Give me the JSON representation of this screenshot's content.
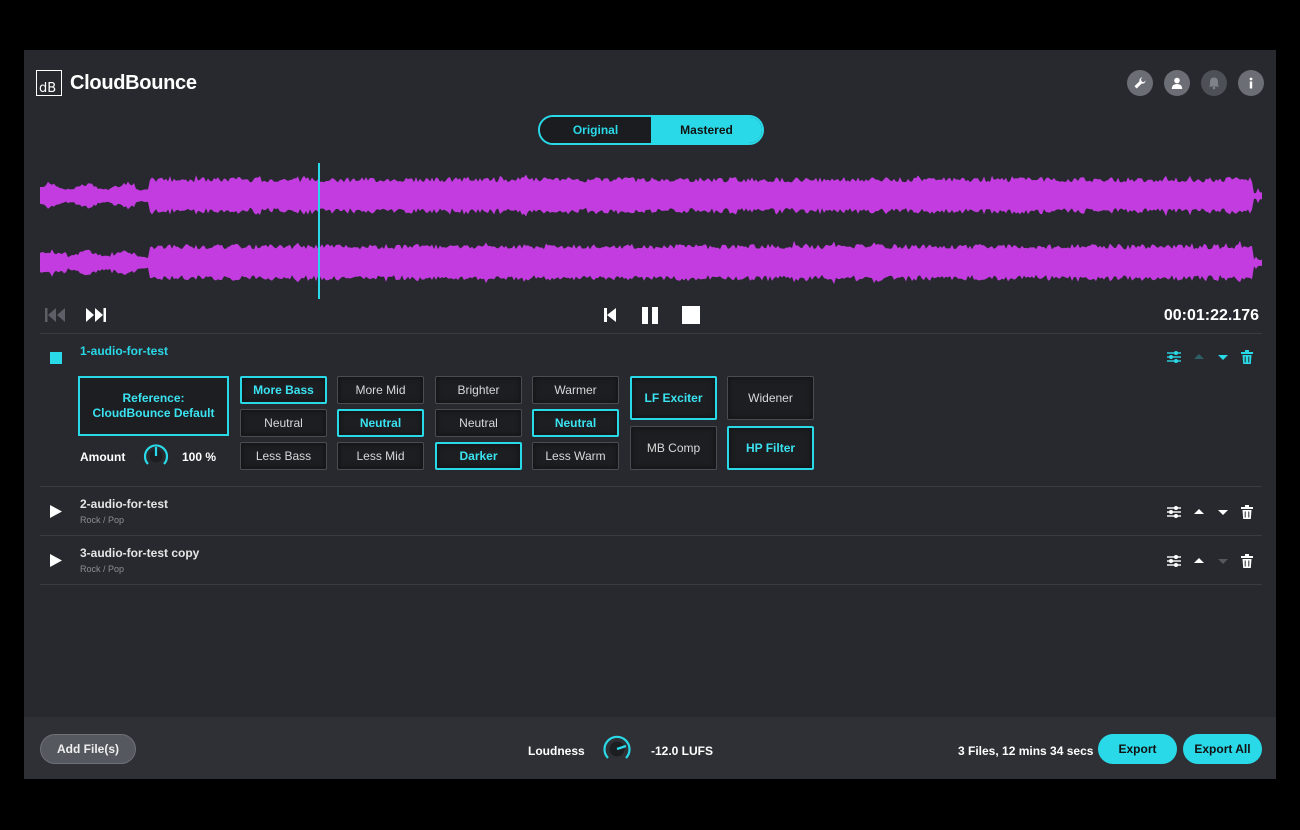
{
  "header": {
    "logo_mark": "dB",
    "app_name": "CloudBounce",
    "icons": [
      "wrench-icon",
      "user-icon",
      "bell-icon",
      "info-icon"
    ]
  },
  "view_toggle": {
    "original_label": "Original",
    "mastered_label": "Mastered",
    "selected": "Mastered"
  },
  "colors": {
    "accent": "#2ad9e8",
    "waveform": "#c23ce0",
    "background": "#27292e"
  },
  "transport": {
    "time": "00:01:22.176"
  },
  "tracks": [
    {
      "name": "1-audio-for-test",
      "expanded": true,
      "reference_line1": "Reference:",
      "reference_line2": "CloudBounce Default",
      "amount_label": "Amount",
      "amount_value": "100 %",
      "eq": {
        "bass": [
          "More Bass",
          "Neutral",
          "Less Bass"
        ],
        "mid": [
          "More Mid",
          "Neutral",
          "Less Mid"
        ],
        "bright": [
          "Brighter",
          "Neutral",
          "Darker"
        ],
        "warm": [
          "Warmer",
          "Neutral",
          "Less Warm"
        ]
      },
      "fx": {
        "lf_exciter": "LF Exciter",
        "widener": "Widener",
        "mb_comp": "MB Comp",
        "hp_filter": "HP Filter"
      }
    },
    {
      "name": "2-audio-for-test",
      "genre": "Rock / Pop"
    },
    {
      "name": "3-audio-for-test copy",
      "genre": "Rock / Pop"
    }
  ],
  "footer": {
    "add_files_label": "Add File(s)",
    "loudness_label": "Loudness",
    "loudness_value": "-12.0 LUFS",
    "files_info": "3 Files, 12 mins 34 secs",
    "export_label": "Export",
    "export_all_label": "Export All"
  }
}
